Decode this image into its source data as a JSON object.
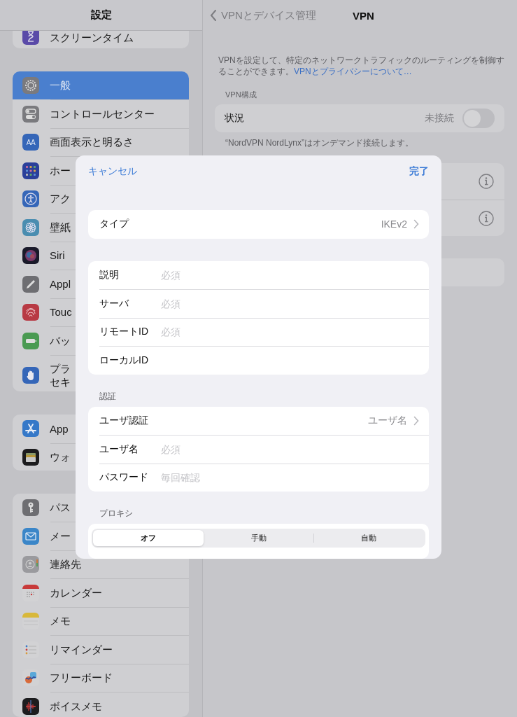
{
  "sidebar": {
    "title": "設定",
    "groups": [
      {
        "items": [
          {
            "label": "スクリーンタイム",
            "selected": false
          }
        ]
      },
      {
        "items": [
          {
            "label": "一般",
            "selected": true
          },
          {
            "label": "コントロールセンター",
            "selected": false
          },
          {
            "label": "画面表示と明るさ",
            "selected": false,
            "icon_label": "AA"
          },
          {
            "label": "ホー",
            "selected": false
          },
          {
            "label": "アク",
            "selected": false
          },
          {
            "label": "壁紙",
            "selected": false
          },
          {
            "label": "Siri",
            "selected": false
          },
          {
            "label": "Appl",
            "selected": false
          },
          {
            "label": "Touc",
            "selected": false
          },
          {
            "label": "バッ",
            "selected": false
          },
          {
            "label_lines": [
              "プラ",
              "セキ"
            ],
            "selected": false
          }
        ]
      },
      {
        "items": [
          {
            "label": "App",
            "selected": false
          },
          {
            "label": "ウォ",
            "selected": false
          }
        ]
      },
      {
        "items": [
          {
            "label": "パス",
            "selected": false
          },
          {
            "label": "メー",
            "selected": false
          },
          {
            "label": "連絡先",
            "selected": false
          },
          {
            "label": "カレンダー",
            "selected": false
          },
          {
            "label": "メモ",
            "selected": false
          },
          {
            "label": "リマインダー",
            "selected": false
          },
          {
            "label": "フリーボード",
            "selected": false
          },
          {
            "label": "ボイスメモ",
            "selected": false
          }
        ]
      }
    ]
  },
  "detail": {
    "back": "VPNとデバイス管理",
    "title": "VPN",
    "description": "VPNを設定して、特定のネットワークトラフィックのルーティングを制御することができます。",
    "link": "VPNとプライバシーについて…",
    "section": "VPN構成",
    "status": {
      "label": "状況",
      "value": "未接続",
      "on": false
    },
    "note": "“NordVPN NordLynx”はオンデマンド接続します。"
  },
  "sheet": {
    "cancel": "キャンセル",
    "done": "完了",
    "groups": [
      {
        "rows": [
          {
            "kind": "picker",
            "label": "タイプ",
            "value": "IKEv2"
          }
        ]
      },
      {
        "rows": [
          {
            "kind": "field",
            "label": "説明",
            "placeholder": "必須"
          },
          {
            "kind": "field",
            "label": "サーバ",
            "placeholder": "必須"
          },
          {
            "kind": "field",
            "label": "リモートID",
            "placeholder": "必須"
          },
          {
            "kind": "field",
            "label": "ローカルID"
          }
        ]
      },
      {
        "header": "認証",
        "rows": [
          {
            "kind": "picker",
            "label": "ユーザ認証",
            "value": "ユーザ名"
          },
          {
            "kind": "field",
            "label": "ユーザ名",
            "placeholder": "必須"
          },
          {
            "kind": "field",
            "label": "パスワード",
            "placeholder": "毎回確認"
          }
        ]
      }
    ],
    "proxy_header": "プロキシ",
    "proxy": [
      {
        "label": "オフ",
        "selected": true
      },
      {
        "label": "手動",
        "selected": false
      },
      {
        "label": "自動",
        "selected": false
      }
    ]
  }
}
